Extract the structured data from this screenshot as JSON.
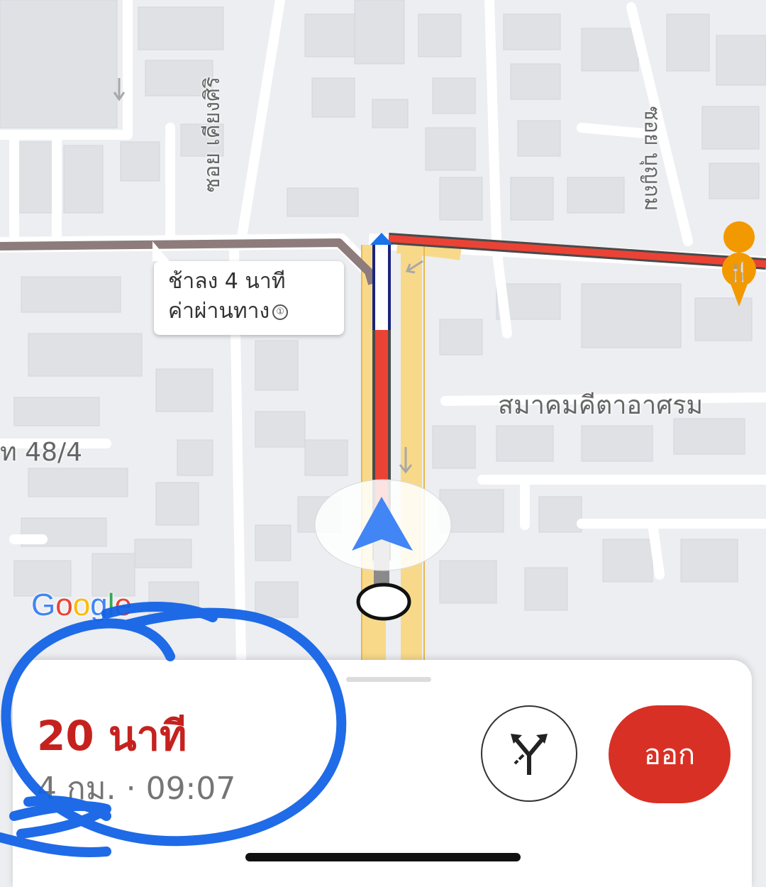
{
  "map": {
    "delay_bubble": {
      "line1": "ช้าลง 4 นาที",
      "line2": "ค่าผ่านทาง",
      "toll_icon": "①"
    },
    "labels": {
      "place": "สมาคมคีตาอาศรม",
      "street_left": "ท 48/4",
      "street_vertical_1": "ซอย เคียงศิริ",
      "street_vertical_2": "ซอย บุญถม"
    },
    "attribution": [
      "G",
      "o",
      "o",
      "g",
      "l",
      "e"
    ],
    "attribution_colors": [
      "#4285f4",
      "#ea4335",
      "#fbbc05",
      "#4285f4",
      "#34a853",
      "#ea4335"
    ],
    "restaurant_icon": "fork-knife-icon",
    "colors": {
      "traffic_heavy": "#ea4335",
      "traffic_delay": "#9e8b89",
      "route_highlight": "#f8d98a",
      "navigation_arrow": "#4285f4"
    }
  },
  "bottom_sheet": {
    "duration": "20 นาที",
    "trip_info": "4 กม. · 09:07",
    "alternate_routes_icon": "alt-routes-icon",
    "exit_button": "ออก",
    "exit_color": "#d93025"
  }
}
